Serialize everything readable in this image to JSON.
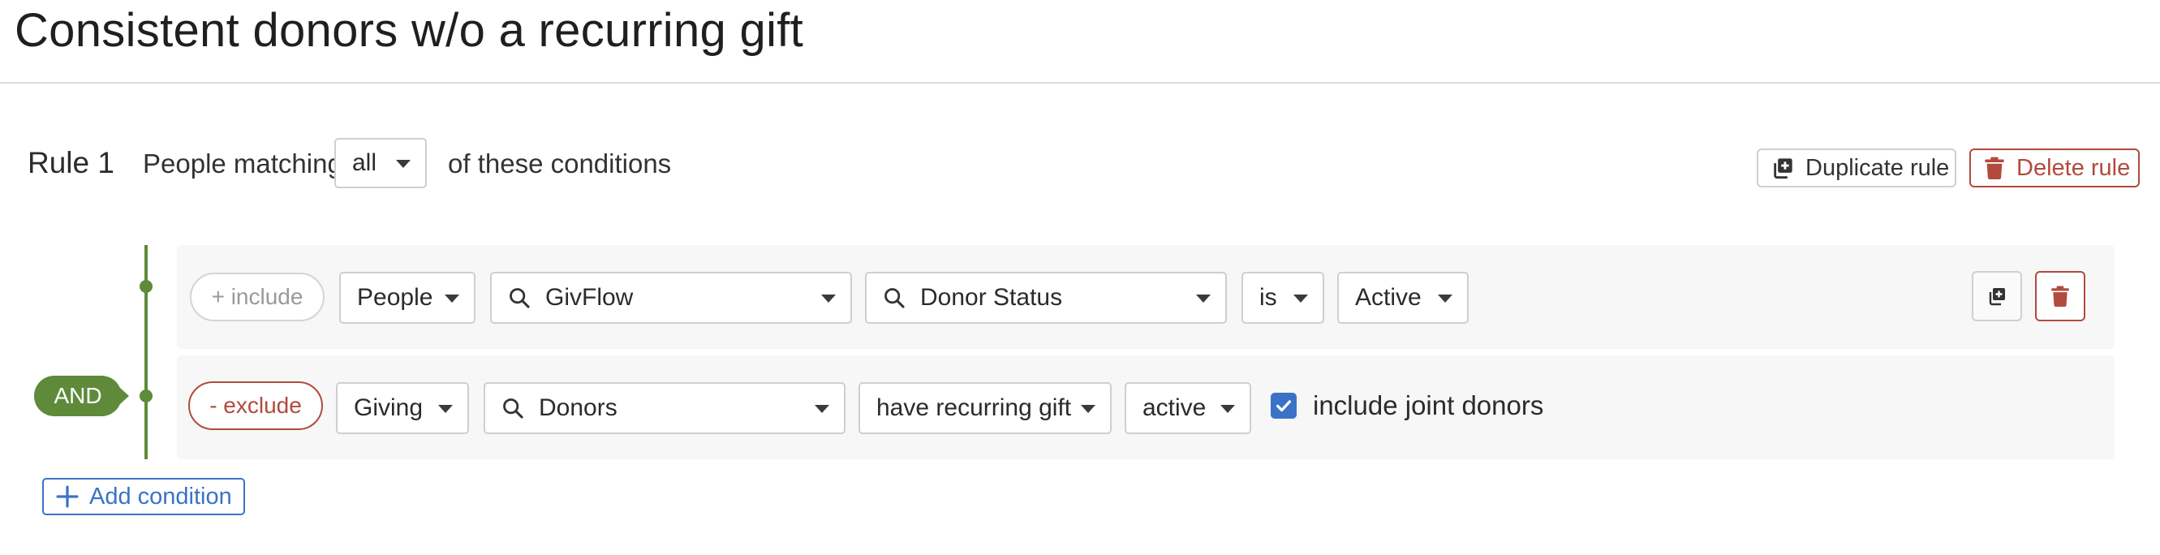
{
  "page": {
    "title": "Consistent donors w/o a recurring gift"
  },
  "rule": {
    "title": "Rule 1",
    "matching_prefix": "People matching",
    "matching_value": "all",
    "matching_suffix": "of these conditions",
    "duplicate_label": "Duplicate rule",
    "delete_label": "Delete rule"
  },
  "connector": {
    "label": "AND"
  },
  "conditions": [
    {
      "mode": "+ include",
      "category": "People",
      "source": "GivFlow",
      "field": "Donor Status",
      "operator": "is",
      "value": "Active"
    },
    {
      "mode": "- exclude",
      "category": "Giving",
      "source": "Donors",
      "field": "have recurring gift",
      "value": "active",
      "checkbox_label": "include joint donors",
      "checkbox_checked": true
    }
  ],
  "add_condition_label": "Add condition",
  "icons": {
    "duplicate": "duplicate-icon",
    "trash": "trash-icon",
    "search": "search-icon",
    "caret": "caret-down-icon",
    "check": "check-icon",
    "plus": "plus-icon"
  },
  "colors": {
    "accent_green": "#5e8a3a",
    "danger_red": "#b24a3e",
    "link_blue": "#3a73c6"
  }
}
